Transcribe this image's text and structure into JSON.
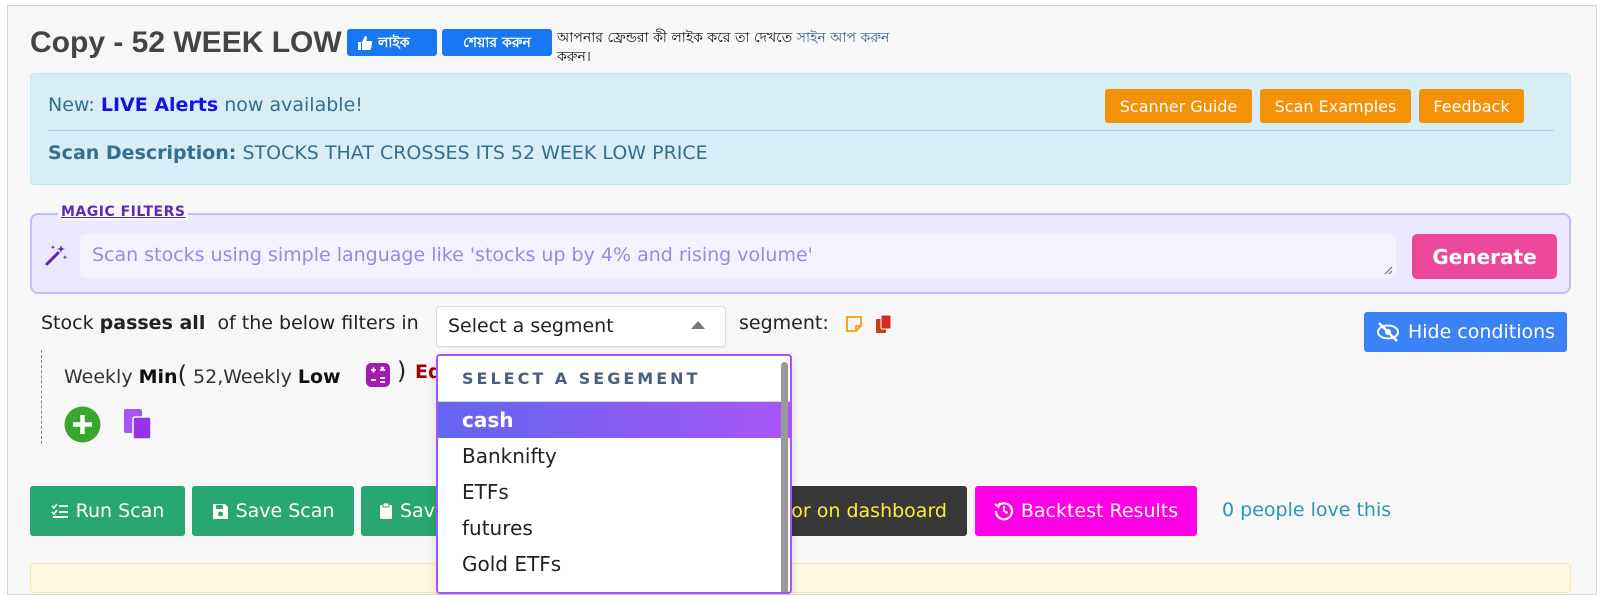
{
  "header": {
    "title": "Copy - 52 WEEK LOW",
    "fb_like_label": "লাইক",
    "fb_share_label": "শেয়ার করুন",
    "fb_text_before": "আপনার ফ্রেন্ডরা কী লাইক করে তা দেখতে",
    "fb_signup_link": "সাইন আপ করুন",
    "fb_text_after": "করুন।"
  },
  "info": {
    "new_prefix": "New:",
    "live_alerts": "LIVE Alerts",
    "new_suffix": "now available!",
    "description_label": "Scan Description:",
    "description": "STOCKS THAT CROSSES ITS 52 WEEK LOW PRICE",
    "buttons": [
      "Scanner Guide",
      "Scan Examples",
      "Feedback"
    ]
  },
  "magic": {
    "label": "MAGIC FILTERS",
    "placeholder": "Scan stocks using simple language like 'stocks up by 4% and rising volume'",
    "generate_label": "Generate"
  },
  "filter": {
    "prefix": "Stock",
    "passes_all": "passes all",
    "middle": "of the below filters in",
    "segment_placeholder": "Select a segment",
    "segment_suffix": "segment:",
    "hide_conditions_label": "Hide conditions"
  },
  "condition": {
    "part1": "Weekly",
    "part2": "Min",
    "open_paren": "(",
    "arg1": "52",
    "comma": ",",
    "part3": "Weekly",
    "part4": "Low",
    "close_paren": ")",
    "trailing": "Ed"
  },
  "actions": {
    "run_scan": "Run Scan",
    "save_scan": "Save Scan",
    "save_as": "Sav",
    "dashboard": "or on dashboard",
    "backtest": "Backtest Results",
    "love": "0 people love this"
  },
  "dropdown": {
    "header": "SELECT A SEGEMENT",
    "items": [
      "cash",
      "Banknifty",
      "ETFs",
      "futures",
      "Gold ETFs"
    ],
    "selected": "cash"
  },
  "colors": {
    "info_bg": "#d9edf7",
    "orange": "#f39107",
    "generate": "#ec4899",
    "hide_btn": "#3b82f6",
    "green": "#28a773",
    "backtest": "#ff00e6",
    "dropdown_selected_from": "#6366f1",
    "dropdown_selected_to": "#a855f7"
  },
  "icons": [
    "thumbs-up-icon",
    "magic-wand-icon",
    "note-icon",
    "copy-icon",
    "eye-slash-icon",
    "calculator-icon",
    "add-circle-icon",
    "paste-icon",
    "list-check-icon",
    "floppy-icon",
    "clipboard-icon",
    "history-icon",
    "caret-up-icon"
  ]
}
